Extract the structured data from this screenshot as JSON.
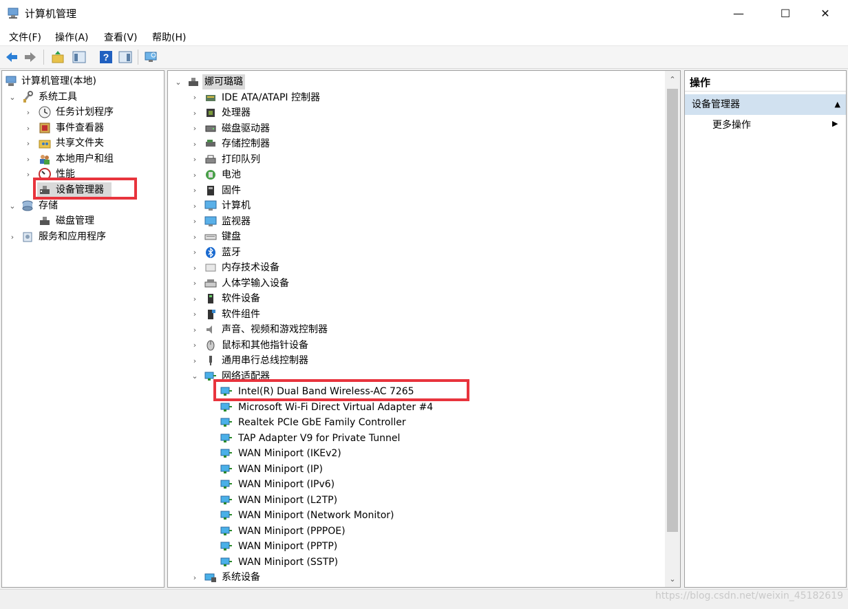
{
  "window": {
    "title": "计算机管理",
    "minimize": "—",
    "maximize": "☐",
    "close": "✕"
  },
  "menu": [
    "文件(F)",
    "操作(A)",
    "查看(V)",
    "帮助(H)"
  ],
  "toolbar": {
    "buttons": [
      "back-arrow-icon",
      "forward-arrow-icon",
      "up-folder-icon",
      "show-hide-console-tree-icon",
      "help-icon",
      "show-hide-action-pane-icon",
      "monitor-scan-icon"
    ]
  },
  "left_tree": {
    "root": "计算机管理(本地)",
    "system_tools": "系统工具",
    "items": [
      "任务计划程序",
      "事件查看器",
      "共享文件夹",
      "本地用户和组",
      "性能",
      "设备管理器"
    ],
    "storage": "存储",
    "disk_management": "磁盘管理",
    "services": "服务和应用程序"
  },
  "device_tree": {
    "root": "娜可璐璐",
    "categories": [
      "IDE ATA/ATAPI 控制器",
      "处理器",
      "磁盘驱动器",
      "存储控制器",
      "打印队列",
      "电池",
      "固件",
      "计算机",
      "监视器",
      "键盘",
      "蓝牙",
      "内存技术设备",
      "人体学输入设备",
      "软件设备",
      "软件组件",
      "声音、视频和游戏控制器",
      "鼠标和其他指针设备",
      "通用串行总线控制器"
    ],
    "network": "网络适配器",
    "network_adapters": [
      "Intel(R) Dual Band Wireless-AC 7265",
      "Microsoft Wi-Fi Direct Virtual Adapter #4",
      "Realtek PCIe GbE Family Controller",
      "TAP Adapter V9 for Private Tunnel",
      "WAN Miniport (IKEv2)",
      "WAN Miniport (IP)",
      "WAN Miniport (IPv6)",
      "WAN Miniport (L2TP)",
      "WAN Miniport (Network Monitor)",
      "WAN Miniport (PPPOE)",
      "WAN Miniport (PPTP)",
      "WAN Miniport (SSTP)"
    ],
    "system_devices": "系统设备"
  },
  "actions": {
    "header": "操作",
    "section": "设备管理器",
    "more": "更多操作"
  },
  "watermark": "https://blog.csdn.net/weixin_45182619",
  "colors": {
    "highlight_red": "#e8343d",
    "selection_blue": "#d1e1f0"
  }
}
